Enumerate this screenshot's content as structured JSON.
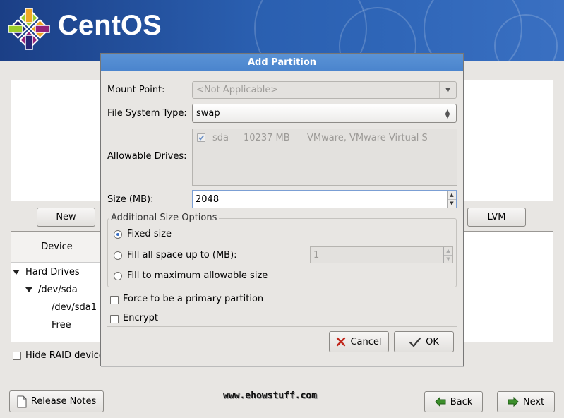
{
  "banner": {
    "logo_text": "CentOS",
    "icon": "centos-logo-icon"
  },
  "partition_area": {
    "buttons": {
      "new": "New",
      "lvm": "LVM"
    },
    "table_header_device": "Device",
    "tree": [
      {
        "label": "Hard Drives",
        "expanded": true
      },
      {
        "label": "/dev/sda",
        "expanded": true
      },
      {
        "label": "/dev/sda1"
      },
      {
        "label": "Free"
      }
    ],
    "hide_raid_label": "Hide RAID device"
  },
  "dialog": {
    "title": "Add Partition",
    "mount_point": {
      "label": "Mount Point:",
      "value": "<Not Applicable>"
    },
    "fs_type": {
      "label": "File System Type:",
      "value": "swap"
    },
    "drives": {
      "label": "Allowable Drives:",
      "items": [
        {
          "name": "sda",
          "size": "10237 MB",
          "model": "VMware, VMware Virtual S",
          "checked": true
        }
      ]
    },
    "size": {
      "label": "Size (MB):",
      "value": "2048"
    },
    "size_options": {
      "title": "Additional Size Options",
      "fixed": "Fixed size",
      "fill_upto": "Fill all space up to (MB):",
      "fill_upto_value": "1",
      "fill_max": "Fill to maximum allowable size",
      "selected": "fixed"
    },
    "force_primary": "Force to be a primary partition",
    "encrypt": "Encrypt",
    "cancel": "Cancel",
    "ok": "OK"
  },
  "footer": {
    "release_notes": "Release Notes",
    "watermark": "www.ehowstuff.com",
    "back": "Back",
    "next": "Next"
  }
}
